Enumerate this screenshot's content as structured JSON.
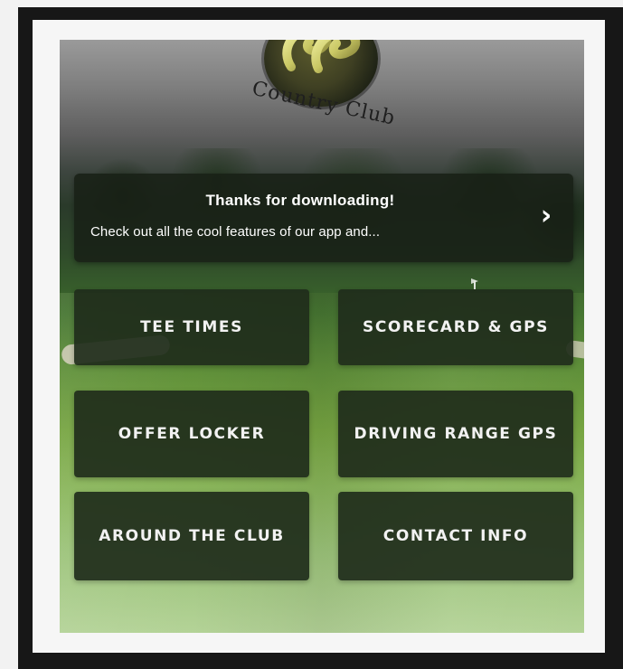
{
  "branding": {
    "logo_text": "Country Club",
    "logo_emblem_letters": "CC"
  },
  "banner": {
    "title": "Thanks for downloading!",
    "subtitle": "Check out all the cool features of our app and...",
    "chevron_icon": "chevron-right-icon"
  },
  "menu": {
    "tiles": [
      {
        "label": "TEE TIMES"
      },
      {
        "label": "SCORECARD & GPS"
      },
      {
        "label": "OFFER LOCKER"
      },
      {
        "label": "DRIVING RANGE GPS"
      },
      {
        "label": "AROUND THE CLUB"
      },
      {
        "label": "CONTACT INFO"
      }
    ]
  },
  "colors": {
    "tile_bg": "#1f2c1b",
    "banner_bg": "#182016",
    "text": "#f2f2f2"
  }
}
